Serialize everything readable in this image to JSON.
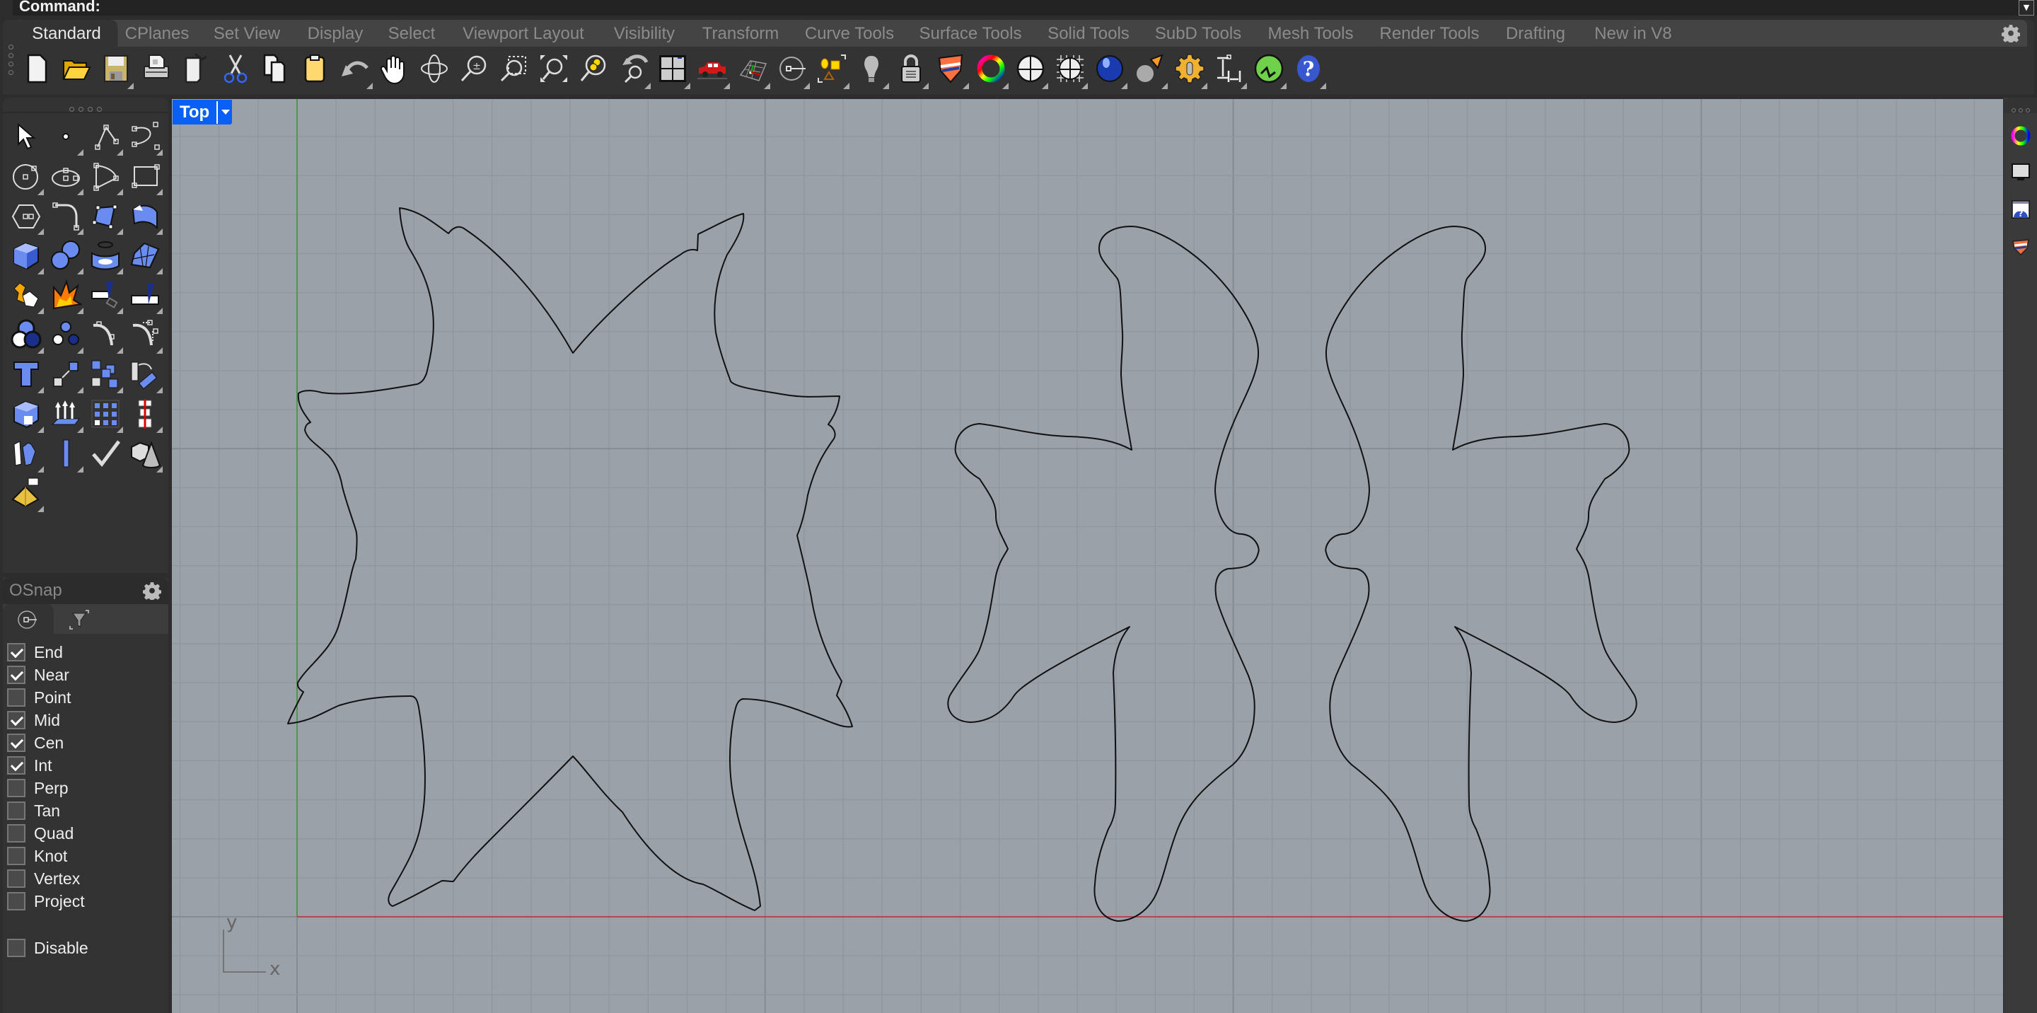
{
  "command": {
    "label": "Command:"
  },
  "toolbar": {
    "tabs": [
      {
        "label": "Standard",
        "active": true
      },
      {
        "label": "CPlanes"
      },
      {
        "label": "Set View"
      },
      {
        "label": "Display"
      },
      {
        "label": "Select"
      },
      {
        "label": "Viewport Layout"
      },
      {
        "label": "Visibility"
      },
      {
        "label": "Transform"
      },
      {
        "label": "Curve Tools"
      },
      {
        "label": "Surface Tools"
      },
      {
        "label": "Solid Tools"
      },
      {
        "label": "SubD Tools"
      },
      {
        "label": "Mesh Tools"
      },
      {
        "label": "Render Tools"
      },
      {
        "label": "Drafting"
      },
      {
        "label": "New in V8"
      }
    ],
    "icons": [
      "new-file-icon",
      "open-folder-icon",
      "save-icon",
      "print-icon",
      "import-icon",
      "cut-icon",
      "copy-icon",
      "paste-icon",
      "undo-icon",
      "pan-hand-icon",
      "rotate-view-icon",
      "zoom-icon",
      "zoom-window-icon",
      "zoom-extents-icon",
      "zoom-selected-icon",
      "undo-view-icon",
      "four-viewports-icon",
      "named-views-car-icon",
      "cplane-icon",
      "osnap-icon",
      "select-objects-icon",
      "lights-bulb-icon",
      "lock-icon",
      "layer-icon",
      "color-wheel-icon",
      "shaded-sphere-icon",
      "wireframe-sphere-icon",
      "rendered-sphere-icon",
      "spotlight-icon",
      "options-gear-icon",
      "dimension-icon",
      "grasshopper-icon",
      "help-icon"
    ]
  },
  "toolbox": {
    "tools": [
      "select-arrow-icon",
      "point-icon",
      "polyline-icon",
      "curve-icon",
      "circle-icon",
      "ellipse-icon",
      "arc-icon",
      "rectangle-icon",
      "polygon-icon",
      "fillet-curve-icon",
      "surface-corner-icon",
      "extrude-surface-icon",
      "box-icon",
      "sphere-union-icon",
      "cylinder-icon",
      "surface-network-icon",
      "join-icon",
      "explode-icon",
      "trim-icon",
      "split-icon",
      "boolean-union-icon",
      "group-icon",
      "fillet-icon",
      "chamfer-icon",
      "text-icon",
      "scale-icon",
      "array-icon",
      "rotate-icon",
      "solid-edit-icon",
      "extrude-icon",
      "grid-array-icon",
      "section-icon",
      "bend-icon",
      "analyze-icon",
      "check-icon",
      "solids-icon",
      "pyramid-icon"
    ]
  },
  "osnap": {
    "title": "OSnap",
    "items": [
      {
        "label": "End",
        "checked": true
      },
      {
        "label": "Near",
        "checked": true
      },
      {
        "label": "Point",
        "checked": false
      },
      {
        "label": "Mid",
        "checked": true
      },
      {
        "label": "Cen",
        "checked": true
      },
      {
        "label": "Int",
        "checked": true
      },
      {
        "label": "Perp",
        "checked": false
      },
      {
        "label": "Tan",
        "checked": false
      },
      {
        "label": "Quad",
        "checked": false
      },
      {
        "label": "Knot",
        "checked": false
      },
      {
        "label": "Vertex",
        "checked": false
      },
      {
        "label": "Project",
        "checked": false
      }
    ],
    "disable": {
      "label": "Disable",
      "checked": false
    }
  },
  "viewport": {
    "name": "Top",
    "axis_x_label": "x",
    "axis_y_label": "y",
    "colors": {
      "background": "#9aa1a9",
      "x_axis": "#b04040",
      "y_axis": "#4aa04a",
      "curve": "#111111",
      "label_bg": "#0a5ff4"
    },
    "objects": [
      "curve-star-shape",
      "curve-butterfly-left",
      "curve-butterfly-right"
    ]
  },
  "right_panel": {
    "icons": [
      "color-wheel-icon",
      "display-monitor-icon",
      "help-window-icon",
      "layers-icon"
    ]
  }
}
